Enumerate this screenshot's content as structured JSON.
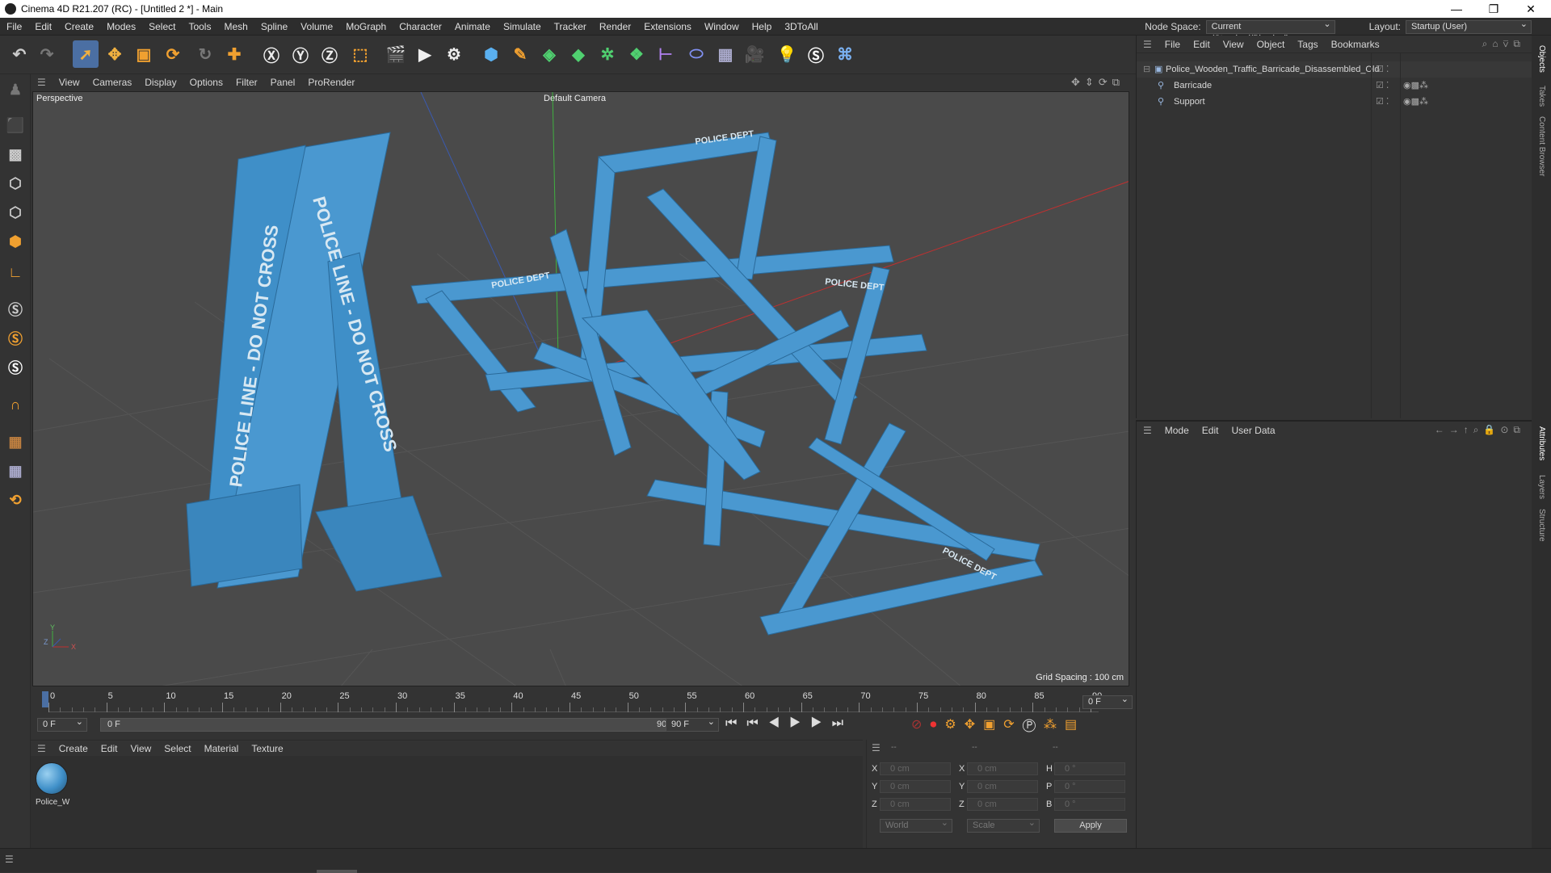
{
  "window": {
    "title": "Cinema 4D R21.207 (RC) - [Untitled 2 *] - Main",
    "controls": [
      "—",
      "❐",
      "✕"
    ]
  },
  "menubar": {
    "items": [
      "File",
      "Edit",
      "Create",
      "Modes",
      "Select",
      "Tools",
      "Mesh",
      "Spline",
      "Volume",
      "MoGraph",
      "Character",
      "Animate",
      "Simulate",
      "Tracker",
      "Render",
      "Extensions",
      "Window",
      "Help",
      "3DToAll"
    ],
    "node_space_label": "Node Space:",
    "node_space_value": "Current (Standard/Physical)",
    "layout_label": "Layout:",
    "layout_value": "Startup (User)"
  },
  "viewport": {
    "menu": [
      "View",
      "Cameras",
      "Display",
      "Options",
      "Filter",
      "Panel",
      "ProRender"
    ],
    "view_name": "Perspective",
    "camera_label": "Default Camera",
    "grid_spacing": "Grid Spacing : 100 cm",
    "axis_labels": {
      "x": "X",
      "y": "Y",
      "z": "Z"
    },
    "sign_texts": [
      "POLICE LINE - DO NOT CROSS",
      "POLICE LINE - DO NOT CROSS",
      "POLICE DEPT",
      "POLICE DEPT",
      "POLICE DEPT",
      "POLICE DEPT"
    ]
  },
  "timeline": {
    "ticks": [
      "0",
      "5",
      "10",
      "15",
      "20",
      "25",
      "30",
      "35",
      "40",
      "45",
      "50",
      "55",
      "60",
      "65",
      "70",
      "75",
      "80",
      "85",
      "90"
    ],
    "current_frame": "0 F",
    "start_field": "0 F",
    "range_start": "0 F",
    "range_end": "90 F",
    "end_field": "90 F"
  },
  "material": {
    "menu": [
      "Create",
      "Edit",
      "View",
      "Select",
      "Material",
      "Texture"
    ],
    "items": [
      {
        "name": "Police_W"
      }
    ]
  },
  "coords": {
    "headers": [
      "--",
      "--",
      "--"
    ],
    "rows": [
      {
        "l1": "X",
        "v1": "0 cm",
        "l2": "X",
        "v2": "0 cm",
        "l3": "H",
        "v3": "0 °"
      },
      {
        "l1": "Y",
        "v1": "0 cm",
        "l2": "Y",
        "v2": "0 cm",
        "l3": "P",
        "v3": "0 °"
      },
      {
        "l1": "Z",
        "v1": "0 cm",
        "l2": "Z",
        "v2": "0 cm",
        "l3": "B",
        "v3": "0 °"
      }
    ],
    "world": "World",
    "scale": "Scale",
    "apply": "Apply"
  },
  "objects_panel": {
    "menu": [
      "File",
      "Edit",
      "View",
      "Object",
      "Tags",
      "Bookmarks"
    ],
    "tree": [
      {
        "name": "Police_Wooden_Traffic_Barricade_Disassembled_Old",
        "level": 0
      },
      {
        "name": "Barricade",
        "level": 1
      },
      {
        "name": "Support",
        "level": 1
      }
    ]
  },
  "attributes_panel": {
    "menu": [
      "Mode",
      "Edit",
      "User Data"
    ]
  },
  "side_tabs": {
    "top": [
      "Objects",
      "Takes",
      "Content Browser"
    ],
    "bottom": [
      "Attributes",
      "Layers",
      "Structure"
    ]
  },
  "colors": {
    "accent": "#4b6fa3",
    "barricade_blue": "#3f8fc8",
    "viewport_bg": "#4a4a4a"
  }
}
